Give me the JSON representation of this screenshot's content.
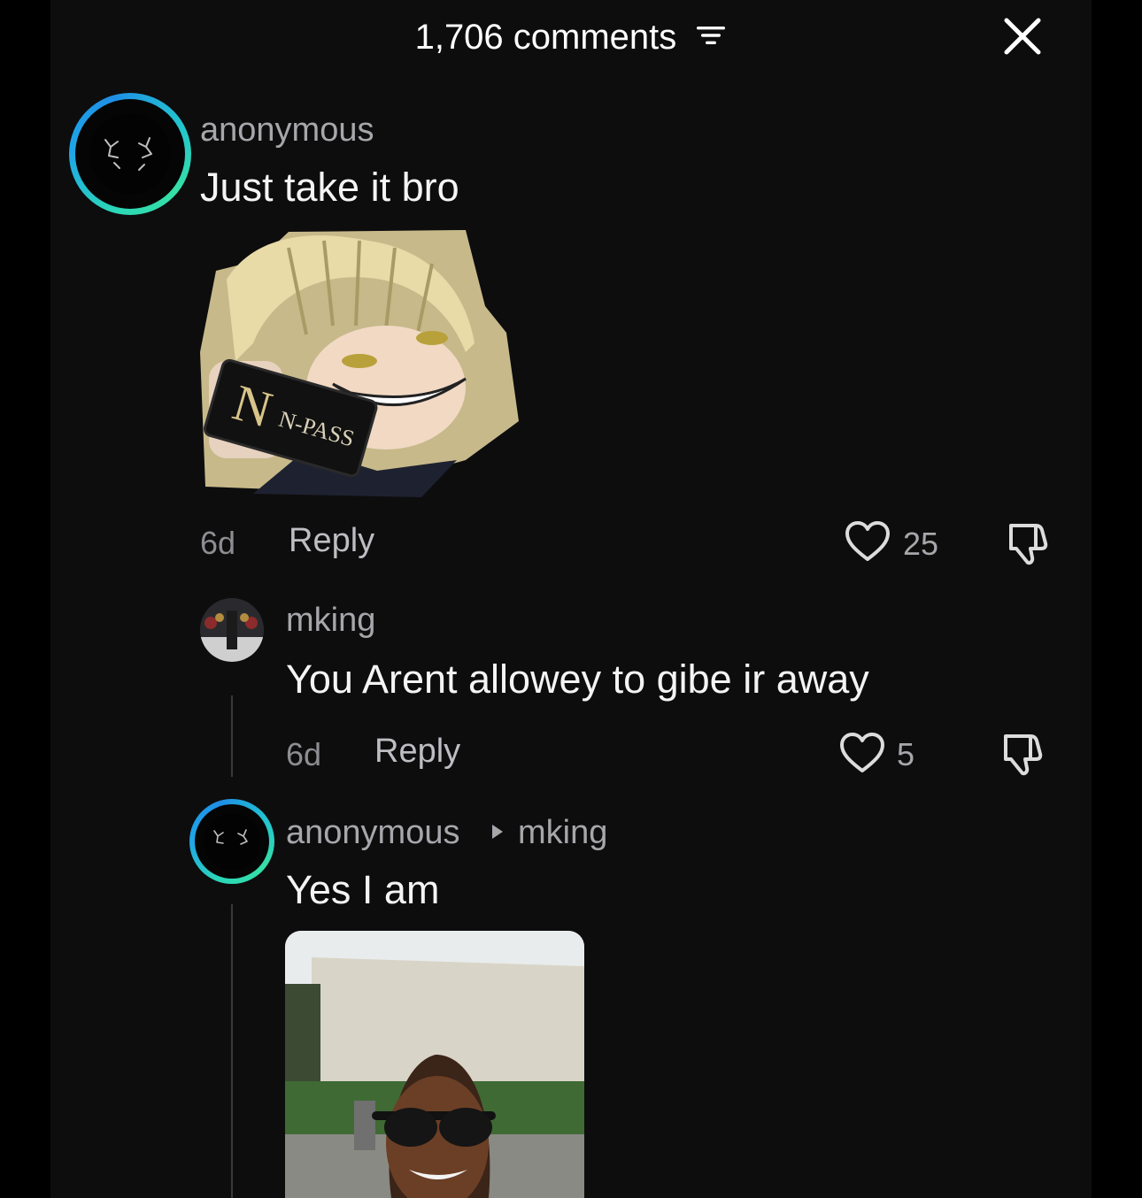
{
  "header": {
    "comments_count": "1,706 comments"
  },
  "comments": [
    {
      "username": "anonymous",
      "text": "Just take it bro",
      "sticker_text": "N-PASS",
      "time": "6d",
      "reply_label": "Reply",
      "likes": "25"
    },
    {
      "username": "mking",
      "text": "You Arent allowey to gibe ir away",
      "time": "6d",
      "reply_label": "Reply",
      "likes": "5"
    },
    {
      "username": "anonymous",
      "reply_to": "mking",
      "text": "Yes I am"
    }
  ],
  "colors": {
    "background": "#0d0d0e",
    "ring_teal": "#2ad6b8",
    "ring_blue": "#1f8fe6"
  }
}
